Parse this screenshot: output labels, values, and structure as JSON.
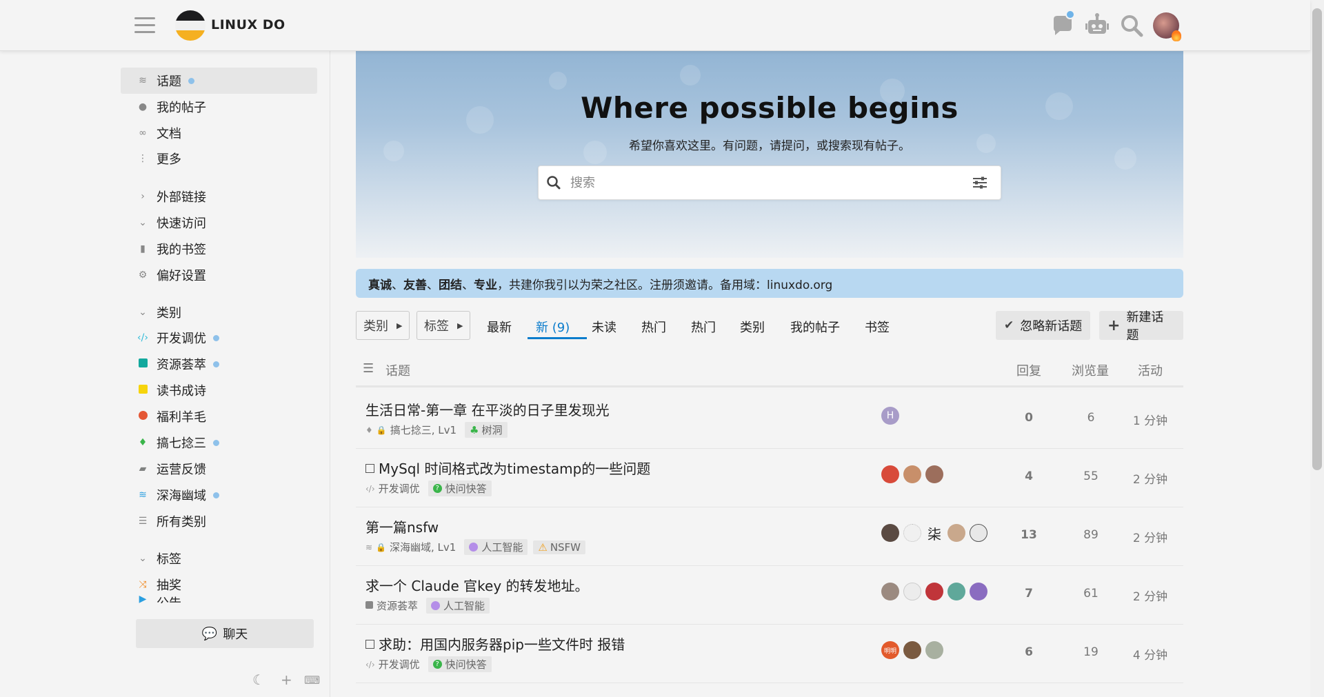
{
  "header": {
    "brand": "LINUX DO"
  },
  "sidebar": {
    "top": [
      {
        "label": "话题",
        "icon": "layers-icon",
        "dot": true
      },
      {
        "label": "我的帖子",
        "icon": "user-icon"
      },
      {
        "label": "文档",
        "icon": "link-icon"
      },
      {
        "label": "更多",
        "icon": "ellipsis-vertical-icon"
      }
    ],
    "sections": [
      {
        "label": "外部链接",
        "collapsed": true
      },
      {
        "label": "快速访问",
        "collapsed": false
      }
    ],
    "quick": [
      {
        "label": "我的书签",
        "icon": "bookmark-icon"
      },
      {
        "label": "偏好设置",
        "icon": "gear-icon"
      }
    ],
    "categories_title": "类别",
    "categories": [
      {
        "label": "开发调优",
        "color": "#2fbbd8",
        "dot": true
      },
      {
        "label": "资源荟萃",
        "color": "#12a89d",
        "dot": true
      },
      {
        "label": "读书成诗",
        "color": "#f6d40c"
      },
      {
        "label": "福利羊毛",
        "color": "#e45735"
      },
      {
        "label": "搞七捻三",
        "color": "#3ab54a",
        "dot": true
      },
      {
        "label": "运营反馈",
        "color": "#808281"
      },
      {
        "label": "深海幽域",
        "color": "#2b9fe0",
        "dot": true
      },
      {
        "label": "所有类别",
        "color": "#888888"
      }
    ],
    "tags_title": "标签",
    "tags": [
      {
        "label": "抽奖"
      },
      {
        "label": "公告"
      }
    ],
    "chat_label": "聊天"
  },
  "banner": {
    "title": "Where possible begins",
    "subtitle": "希望你喜欢这里。有问题，请提问，或搜索现有帖子。",
    "search_placeholder": "搜索"
  },
  "notice": {
    "w1": "真诚",
    "sep1": "、",
    "w2": "友善",
    "sep2": "、",
    "w3": "团结",
    "sep3": "、",
    "w4": "专业",
    "rest": "，共建你我引以为荣之社区。注册须邀请。备用域：linuxdo.org"
  },
  "nav": {
    "category_dd": "类别",
    "tag_dd": "标签",
    "tabs": [
      "最新",
      "新 (9)",
      "未读",
      "热门",
      "热门",
      "类别",
      "我的帖子",
      "书签"
    ],
    "active_tab": 1,
    "dismiss": "忽略新话题",
    "new_topic": "新建话题"
  },
  "table": {
    "col_topic": "话题",
    "col_replies": "回复",
    "col_views": "浏览量",
    "col_activity": "活动",
    "rows": [
      {
        "title": "生活日常-第一章 在平淡的日子里发现光",
        "checkbox": false,
        "category": "搞七捻三, Lv1",
        "locked": true,
        "tags": [
          {
            "label": "树洞",
            "icon": "tree-icon",
            "color": "#3ab54a"
          }
        ],
        "replies": "0",
        "views": "6",
        "activity": "1 分钟",
        "posters": [
          "#a89cc8"
        ],
        "poster_letter": "H"
      },
      {
        "title": "MySql 时间格式改为timestamp的一些问题",
        "checkbox": true,
        "category": "开发调优",
        "locked": false,
        "tags": [
          {
            "label": "快问快答",
            "icon": "question-circle-icon",
            "color": "#3ab54a"
          }
        ],
        "replies": "4",
        "views": "55",
        "activity": "2 分钟",
        "posters": [
          "#d84a3a",
          "#c88f6a",
          "#9c6e5c"
        ]
      },
      {
        "title": "第一篇nsfw",
        "checkbox": false,
        "category": "深海幽域, Lv1",
        "locked": true,
        "tags": [
          {
            "label": "人工智能",
            "icon": "brain-icon",
            "color": "#b48ee8"
          },
          {
            "label": "NSFW",
            "icon": "warning-icon",
            "color": "#f0a020"
          }
        ],
        "replies": "13",
        "views": "89",
        "activity": "2 分钟",
        "posters": [
          "#5a4a42",
          "#f0f0f0",
          "#f4f4f4",
          "#c9a88c",
          "#e8e8e8"
        ],
        "poster_text": "柒"
      },
      {
        "title": "求一个 Claude 官key 的转发地址。",
        "checkbox": false,
        "category": "资源荟萃",
        "locked": false,
        "tags": [
          {
            "label": "人工智能",
            "icon": "brain-icon",
            "color": "#b48ee8"
          }
        ],
        "replies": "7",
        "views": "61",
        "activity": "2 分钟",
        "posters": [
          "#9b8a80",
          "#ececec",
          "#c0353a",
          "#5fa89a",
          "#8a6cc0"
        ]
      },
      {
        "title": "求助：用国内服务器pip一些文件时 报错",
        "checkbox": true,
        "category": "开发调优",
        "locked": false,
        "tags": [
          {
            "label": "快问快答",
            "icon": "question-circle-icon",
            "color": "#3ab54a"
          }
        ],
        "replies": "6",
        "views": "19",
        "activity": "4 分钟",
        "posters": [
          "#e25a2c",
          "#7a5a40",
          "#a8b0a0"
        ],
        "poster_text": "明明"
      }
    ]
  }
}
